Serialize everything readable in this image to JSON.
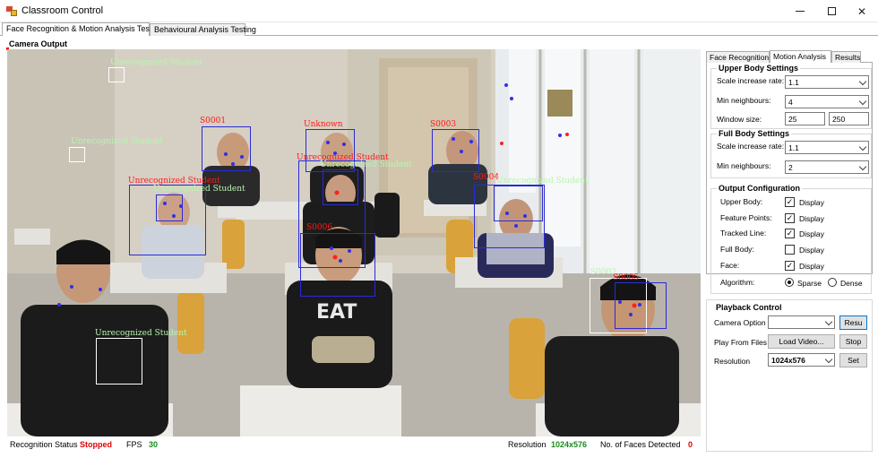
{
  "window": {
    "title": "Classroom Control"
  },
  "main_tabs": [
    "Face Recognition & Motion Analysis Testing",
    "Behavioural Analysis Testing"
  ],
  "camera": {
    "label": "Camera Output"
  },
  "detections": [
    {
      "label": "Unrecognized Student",
      "color": "#b8f5b0"
    },
    {
      "label": "Unrecognized Student",
      "color": "#b8f5b0"
    },
    {
      "label": "S0001",
      "color": "#ff1a1a"
    },
    {
      "label": "Unknown",
      "color": "#ff1a1a"
    },
    {
      "label": "S0003",
      "color": "#ff1a1a"
    },
    {
      "label": "Unrecognized Student",
      "color": "#ff1a1a"
    },
    {
      "label": "Unrecognized Student",
      "color": "#b8f5b0"
    },
    {
      "label": "Unrecognized Student",
      "color": "#ff1a1a"
    },
    {
      "label": "Unrecognized Student",
      "color": "#b8f5b0"
    },
    {
      "label": "S0004",
      "color": "#ff1a1a"
    },
    {
      "label": "Unrecognized Student",
      "color": "#b8f5b0"
    },
    {
      "label": "S0006",
      "color": "#ff1a1a"
    },
    {
      "label": "S0002",
      "color": "#b8f5b0"
    },
    {
      "label": "S0005",
      "color": "#ff1a1a"
    },
    {
      "label": "Unrecognized Student",
      "color": "#b8f5b0"
    }
  ],
  "status": {
    "recognition_label": "Recognition Status",
    "recognition_value": "Stopped",
    "fps_label": "FPS",
    "fps_value": "30",
    "resolution_label": "Resolution",
    "resolution_value": "1024x576",
    "faces_label": "No. of Faces Detected",
    "faces_value": "0"
  },
  "right_tabs": [
    "Face Recognition",
    "Motion Analysis",
    "Results"
  ],
  "upper_body": {
    "title": "Upper Body Settings",
    "scale_label": "Scale increase rate:",
    "scale_value": "1.1",
    "neighbours_label": "Min neighbours:",
    "neighbours_value": "4",
    "window_label": "Window size:",
    "window_w": "25",
    "window_h": "250"
  },
  "full_body": {
    "title": "Full Body Settings",
    "scale_label": "Scale increase rate:",
    "scale_value": "1.1",
    "neighbours_label": "Min neighbours:",
    "neighbours_value": "2"
  },
  "output_config": {
    "title": "Output Configuration",
    "rows": [
      {
        "label": "Upper Body:",
        "option": "Display",
        "checked": true
      },
      {
        "label": "Feature Points:",
        "option": "Display",
        "checked": true
      },
      {
        "label": "Tracked Line:",
        "option": "Display",
        "checked": true
      },
      {
        "label": "Full Body:",
        "option": "Display",
        "checked": false
      },
      {
        "label": "Face:",
        "option": "Display",
        "checked": true
      }
    ],
    "algorithm_label": "Algorithm:",
    "algorithm_options": [
      "Sparse",
      "Dense"
    ],
    "algorithm_selected": "Sparse"
  },
  "playback": {
    "title": "Playback Control",
    "camera_label": "Camera Option",
    "camera_value": "",
    "reset_label": "Resu",
    "play_label": "Play From Files",
    "load_label": "Load Video...",
    "stop_label": "Stop",
    "resolution_label": "Resolution",
    "resolution_value": "1024x576",
    "set_label": "Set"
  }
}
